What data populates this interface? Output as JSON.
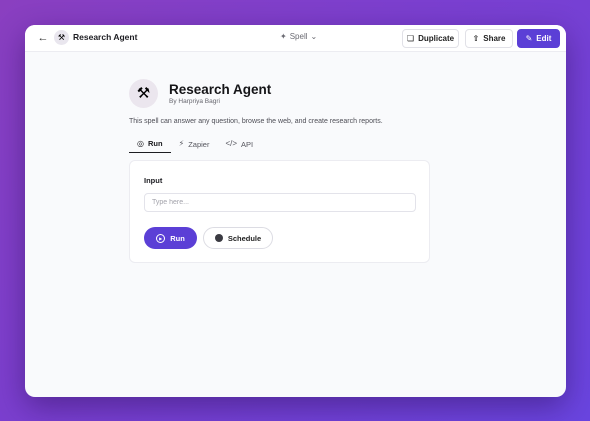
{
  "header": {
    "back_icon": "arrow-left-icon",
    "app_icon": "tools-icon",
    "app_title": "Research Agent",
    "type_label": "Spell",
    "duplicate_label": "Duplicate",
    "share_label": "Share",
    "edit_label": "Edit"
  },
  "agent": {
    "icon": "tools-icon",
    "name": "Research Agent",
    "author": "By Harpriya Bagri",
    "description": "This spell can answer any question, browse the web, and create research reports."
  },
  "tabs": [
    {
      "label": "Run",
      "icon": "play-circle-icon",
      "active": true
    },
    {
      "label": "Zapier",
      "icon": "bolt-icon",
      "active": false
    },
    {
      "label": "API",
      "icon": "code-icon",
      "active": false
    }
  ],
  "form": {
    "input_label": "Input",
    "input_placeholder": "Type here...",
    "input_value": "",
    "run_label": "Run",
    "schedule_label": "Schedule"
  },
  "colors": {
    "accent": "#5b3fd6",
    "background_gradient_start": "#8a3fc0",
    "background_gradient_end": "#6a45e0"
  }
}
